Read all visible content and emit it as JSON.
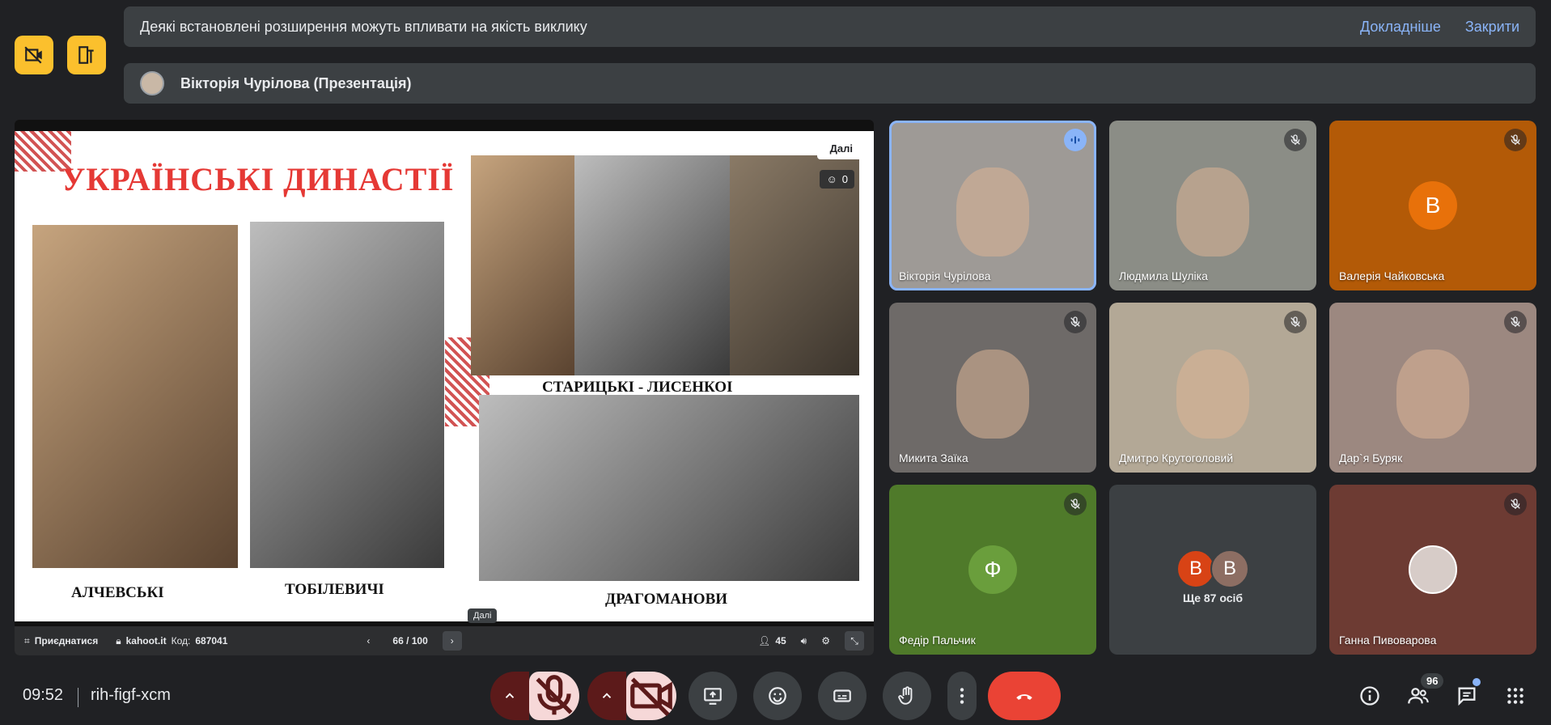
{
  "banner": {
    "message": "Деякі встановлені розширення можуть впливати на якість виклику",
    "learn_more": "Докладніше",
    "close": "Закрити"
  },
  "presenter": {
    "name": "Вікторія Чурілова (Презентація)"
  },
  "slide": {
    "title": "УКРАЇНСЬКІ ДИНАСТІЇ",
    "captions": [
      "АЛЧЕВСЬКІ",
      "ТОБІЛЕВИЧІ",
      "СТАРИЦЬКІ - ЛИСЕНКОІ",
      "ДРАГОМАНОВИ"
    ],
    "next_label": "Далі",
    "reactions_count": "0"
  },
  "slide_controls": {
    "join_label": "Приєднатися",
    "site": "kahoot.it",
    "code_label": "Код:",
    "code_value": "687041",
    "page": "66 / 100",
    "participants": "45",
    "tooltip": "Далі"
  },
  "participants": [
    {
      "name": "Вікторія Чурілова",
      "type": "video",
      "speaking": true,
      "bg": "#9e9a96"
    },
    {
      "name": "Людмила Шуліка",
      "type": "video",
      "muted": true,
      "bg": "#8b8d86"
    },
    {
      "name": "Валерія Чайковська",
      "type": "avatar",
      "letter": "В",
      "muted": true,
      "bg": "#b35a07",
      "avatar_color": "#e8710a"
    },
    {
      "name": "Микита Заїка",
      "type": "video",
      "muted": true,
      "bg": "#6e6a68"
    },
    {
      "name": "Дмитро Крутоголовий",
      "type": "video",
      "muted": true,
      "bg": "#b3a896"
    },
    {
      "name": "Дар`я Буряк",
      "type": "video",
      "muted": true,
      "bg": "#9c8880"
    },
    {
      "name": "Федір Пальчик",
      "type": "avatar",
      "letter": "Ф",
      "muted": true,
      "bg": "#4f7a2a",
      "avatar_color": "#6a9e3c"
    },
    {
      "name": "Ганна Пивоварова",
      "type": "avatar-photo",
      "muted": true,
      "bg": "#6d3b33"
    }
  ],
  "more": {
    "avatars": [
      {
        "letter": "В",
        "color": "#d84315"
      },
      {
        "letter": "В",
        "color": "#8d6e63"
      }
    ],
    "label": "Ще 87 осіб"
  },
  "bottom": {
    "time": "09:52",
    "meeting_code": "rih-figf-xcm",
    "people_count": "96"
  }
}
